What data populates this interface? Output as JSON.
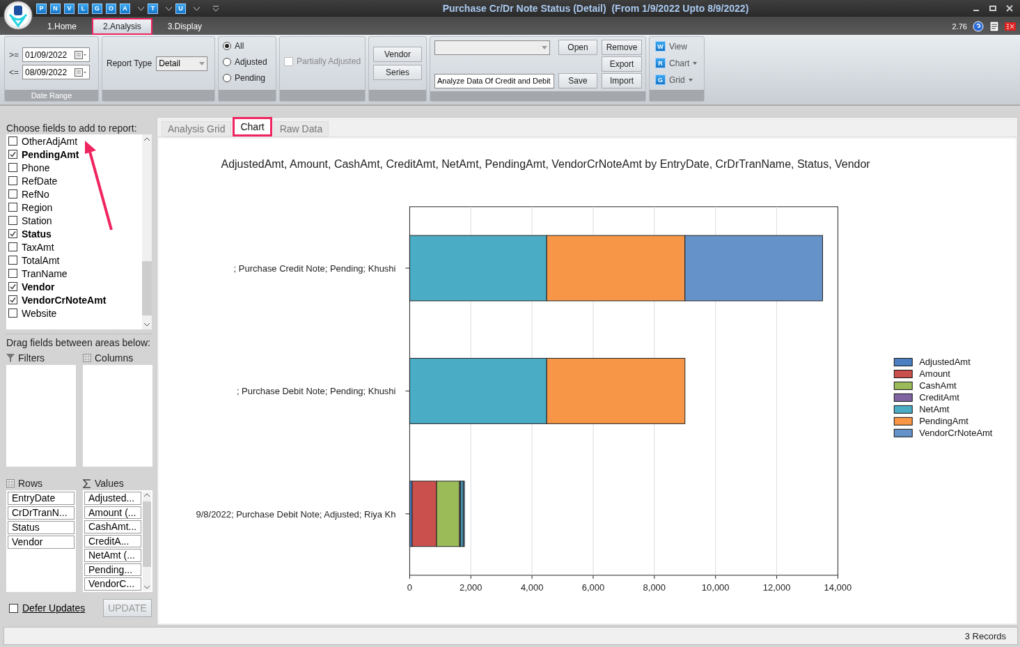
{
  "window": {
    "title": "Purchase Cr/Dr Note Status (Detail)  (From 1/9/2022 Upto 8/9/2022)"
  },
  "quick_access": [
    {
      "label": "P",
      "dropdown": false
    },
    {
      "label": "N",
      "dropdown": false
    },
    {
      "label": "V",
      "dropdown": false
    },
    {
      "label": "L",
      "dropdown": false
    },
    {
      "label": "G",
      "dropdown": false
    },
    {
      "label": "O",
      "dropdown": false
    },
    {
      "label": "A",
      "dropdown": true
    },
    {
      "label": "T",
      "dropdown": true
    },
    {
      "label": "U",
      "dropdown": true
    }
  ],
  "ribbon_tabs": [
    {
      "label": "1.Home",
      "selected": false
    },
    {
      "label": "2.Analysis",
      "selected": true
    },
    {
      "label": "3.Display",
      "selected": false
    }
  ],
  "version": "2.76",
  "ribbon": {
    "date_range": {
      "caption": "Date Range",
      "rows": [
        {
          "op": ">=",
          "value": "01/09/2022"
        },
        {
          "op": "<=",
          "value": "08/09/2022"
        }
      ]
    },
    "report_type": {
      "label": "Report Type",
      "value": "Detail"
    },
    "status_options": [
      {
        "label": "All",
        "selected": true
      },
      {
        "label": "Adjusted",
        "selected": false
      },
      {
        "label": "Pending",
        "selected": false
      }
    ],
    "partially_adjusted": {
      "label": "Partially Adjusted",
      "checked": false,
      "disabled": true
    },
    "group_buttons": [
      "Vendor",
      "Series"
    ],
    "layout": {
      "description": "Analyze Data Of Credit and Debit",
      "open": "Open",
      "save": "Save",
      "remove": "Remove",
      "export": "Export",
      "import": "Import"
    },
    "views": [
      {
        "label": "View",
        "letter": "W",
        "dropdown": false
      },
      {
        "label": "Chart",
        "letter": "R",
        "dropdown": true
      },
      {
        "label": "Grid",
        "letter": "G",
        "dropdown": true
      }
    ]
  },
  "field_list": {
    "heading": "Choose fields to add to report:",
    "fields": [
      {
        "name": "OtherAdjAmt",
        "checked": false
      },
      {
        "name": "PendingAmt",
        "checked": true
      },
      {
        "name": "Phone",
        "checked": false
      },
      {
        "name": "RefDate",
        "checked": false
      },
      {
        "name": "RefNo",
        "checked": false
      },
      {
        "name": "Region",
        "checked": false
      },
      {
        "name": "Station",
        "checked": false
      },
      {
        "name": "Status",
        "checked": true
      },
      {
        "name": "TaxAmt",
        "checked": false
      },
      {
        "name": "TotalAmt",
        "checked": false
      },
      {
        "name": "TranName",
        "checked": false
      },
      {
        "name": "Vendor",
        "checked": true
      },
      {
        "name": "VendorCrNoteAmt",
        "checked": true
      },
      {
        "name": "Website",
        "checked": false
      }
    ],
    "areas_heading": "Drag fields between areas below:",
    "filters": {
      "label": "Filters"
    },
    "columns": {
      "label": "Columns"
    },
    "rows": {
      "label": "Rows",
      "items": [
        "EntryDate",
        "CrDrTranN...",
        "Status",
        "Vendor"
      ]
    },
    "values": {
      "label": "Values",
      "items": [
        "Adjusted...",
        "Amount (...",
        "CashAmt...",
        "CreditA...",
        "NetAmt (...",
        "Pending...",
        "VendorC..."
      ]
    },
    "defer_updates": {
      "label": "Defer Updates",
      "checked": false
    },
    "update_button": "UPDATE"
  },
  "view_tabs": [
    {
      "label": "Analysis Grid",
      "selected": false
    },
    {
      "label": "Chart",
      "selected": true
    },
    {
      "label": "Raw Data",
      "selected": false
    }
  ],
  "chart": {
    "chart_data": {
      "type": "bar",
      "orientation": "horizontal",
      "stacked": true,
      "title": "AdjustedAmt,  Amount,  CashAmt,  CreditAmt,  NetAmt,  PendingAmt,  VendorCrNoteAmt  by  EntryDate,  CrDrTranName,  Status,  Vendor",
      "categories": [
        "; Purchase Credit Note; Pending; Khushi",
        "; Purchase Debit Note; Pending; Khushi",
        "9/8/2022; Purchase Debit Note; Adjusted; Riya Kh"
      ],
      "grid": true,
      "legend": true,
      "xlim": [
        0,
        14000
      ],
      "xticks": [
        {
          "value": 0,
          "label": "0"
        },
        {
          "value": 2000,
          "label": "2,000"
        },
        {
          "value": 4000,
          "label": "4,000"
        },
        {
          "value": 6000,
          "label": "6,000"
        },
        {
          "value": 8000,
          "label": "8,000"
        },
        {
          "value": 10000,
          "label": "10,000"
        },
        {
          "value": 12000,
          "label": "12,000"
        },
        {
          "value": 14000,
          "label": "14,000"
        }
      ],
      "series": [
        {
          "name": "AdjustedAmt",
          "color": "#4a7fc1",
          "values": [
            0,
            0,
            80
          ]
        },
        {
          "name": "Amount",
          "color": "#c9504c",
          "values": [
            0,
            0,
            800
          ]
        },
        {
          "name": "CashAmt",
          "color": "#9bbb59",
          "values": [
            0,
            0,
            750
          ]
        },
        {
          "name": "CreditAmt",
          "color": "#8064a2",
          "values": [
            0,
            0,
            40
          ]
        },
        {
          "name": "NetAmt",
          "color": "#4bacc6",
          "values": [
            4480,
            4480,
            80
          ]
        },
        {
          "name": "PendingAmt",
          "color": "#f79646",
          "values": [
            4520,
            4520,
            0
          ]
        },
        {
          "name": "VendorCrNoteAmt",
          "color": "#6592c8",
          "values": [
            4500,
            0,
            40
          ]
        }
      ]
    }
  },
  "status_bar": {
    "records": "3 Records"
  }
}
